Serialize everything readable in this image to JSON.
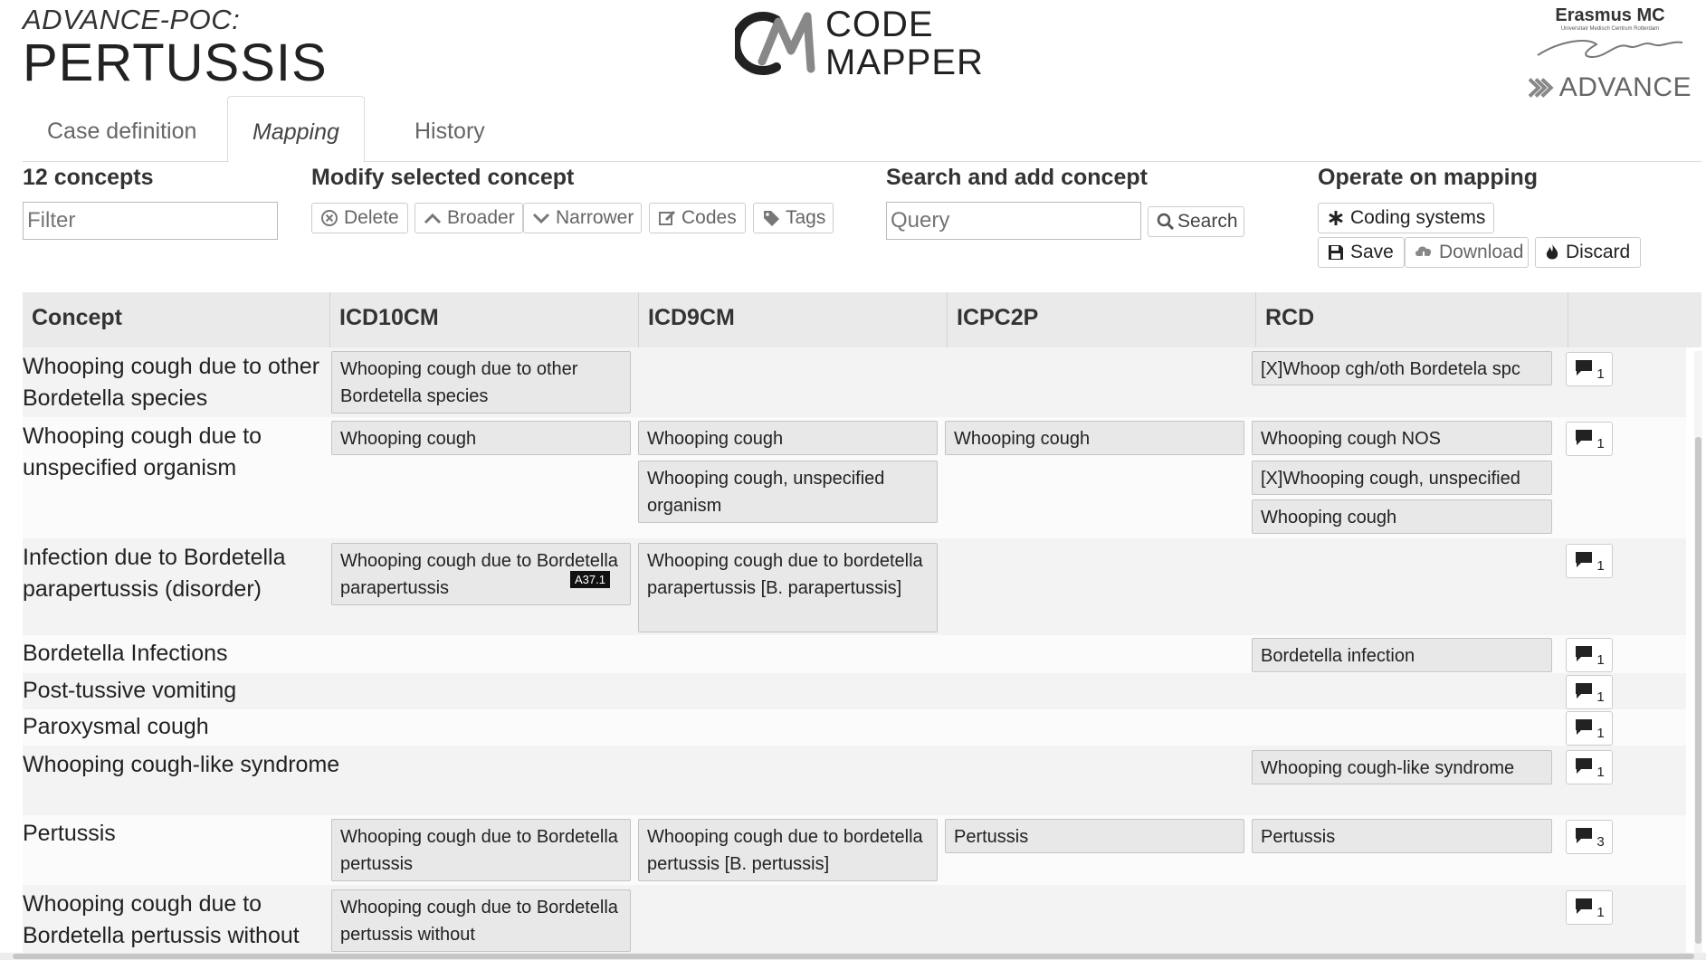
{
  "project": {
    "subtitle": "ADVANCE-POC:",
    "title": "PERTUSSIS"
  },
  "app_logo": {
    "line1": "CODE",
    "line2": "MAPPER"
  },
  "partner_logos": {
    "erasmus": "Erasmus MC",
    "erasmus_sub": "Universitair Medisch Centrum Rotterdam",
    "advance": "ADVANCE"
  },
  "tabs": [
    {
      "label": "Case definition",
      "active": false
    },
    {
      "label": "Mapping",
      "active": true
    },
    {
      "label": "History",
      "active": false
    }
  ],
  "concepts_panel": {
    "count_label": "12 concepts",
    "filter_placeholder": "Filter"
  },
  "modify_panel": {
    "title": "Modify selected concept",
    "buttons": {
      "delete": "Delete",
      "broader": "Broader",
      "narrower": "Narrower",
      "codes": "Codes",
      "tags": "Tags"
    }
  },
  "search_panel": {
    "title": "Search and add concept",
    "query_placeholder": "Query",
    "search_button": "Search"
  },
  "operate_panel": {
    "title": "Operate on mapping",
    "buttons": {
      "coding_systems": "Coding systems",
      "save": "Save",
      "download": "Download",
      "discard": "Discard"
    }
  },
  "table": {
    "headers": [
      "Concept",
      "ICD10CM",
      "ICD9CM",
      "ICPC2P",
      "RCD"
    ],
    "rows": [
      {
        "concept": "Whooping cough due to other Bordetella species",
        "icd10cm": [
          "Whooping cough due to other Bordetella species"
        ],
        "icd9cm": [],
        "icpc2p": [],
        "rcd": [
          "[X]Whoop cgh/oth Bordetela spc"
        ],
        "comments": "1"
      },
      {
        "concept": "Whooping cough due to unspecified organism",
        "icd10cm": [
          "Whooping cough"
        ],
        "icd9cm": [
          "Whooping cough",
          "Whooping cough, unspecified organism"
        ],
        "icpc2p": [
          "Whooping cough"
        ],
        "rcd": [
          "Whooping cough NOS",
          "[X]Whooping cough, unspecified",
          "Whooping cough"
        ],
        "comments": "1"
      },
      {
        "concept": "Infection due to Bordetella parapertussis (disorder)",
        "icd10cm": [
          "Whooping cough due to Bordetella parapertussis"
        ],
        "icd10cm_tag": "A37.1",
        "icd9cm": [
          "Whooping cough due to bordetella parapertussis [B. parapertussis]"
        ],
        "icpc2p": [],
        "rcd": [],
        "comments": "1"
      },
      {
        "concept": "Bordetella Infections",
        "icd10cm": [],
        "icd9cm": [],
        "icpc2p": [],
        "rcd": [
          "Bordetella infection"
        ],
        "comments": "1"
      },
      {
        "concept": "Post-tussive vomiting",
        "icd10cm": [],
        "icd9cm": [],
        "icpc2p": [],
        "rcd": [],
        "comments": "1"
      },
      {
        "concept": "Paroxysmal cough",
        "icd10cm": [],
        "icd9cm": [],
        "icpc2p": [],
        "rcd": [],
        "comments": "1"
      },
      {
        "concept": "Whooping cough-like syndrome",
        "icd10cm": [],
        "icd9cm": [],
        "icpc2p": [],
        "rcd": [
          "Whooping cough-like syndrome"
        ],
        "comments": "1"
      },
      {
        "concept": "Pertussis",
        "icd10cm": [
          "Whooping cough due to Bordetella pertussis"
        ],
        "icd9cm": [
          "Whooping cough due to bordetella pertussis [B. pertussis]"
        ],
        "icpc2p": [
          "Pertussis"
        ],
        "rcd": [
          "Pertussis"
        ],
        "comments": "3"
      },
      {
        "concept": "Whooping cough due to Bordetella pertussis without",
        "icd10cm": [
          "Whooping cough due to Bordetella pertussis without"
        ],
        "icd9cm": [],
        "icpc2p": [],
        "rcd": [],
        "comments": "1"
      }
    ]
  }
}
